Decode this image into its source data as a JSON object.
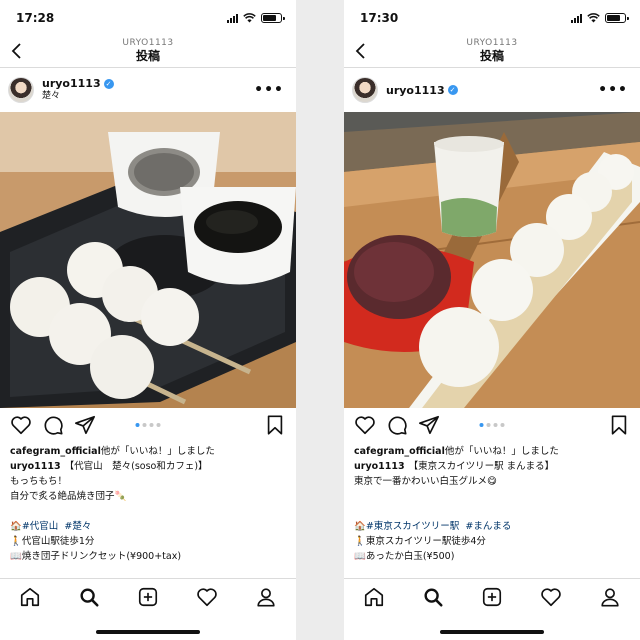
{
  "screens": [
    {
      "status_time": "17:28",
      "nav": {
        "account_id": "URYO1113",
        "title": "投稿"
      },
      "post": {
        "username": "uryo1113",
        "location": "楚々",
        "liked_by_user": "cafegram_official",
        "liked_by_text": "他が「いいね！」しました",
        "caption_user": "uryo1113",
        "caption_lines": [
          "【代官山　楚々(soso和カフェ)】",
          "もっちもち！",
          "自分で炙る絶品焼き団子🍡"
        ],
        "tags_prefix": "🏠",
        "tags": [
          "#代官山",
          "#楚々"
        ],
        "access": "🚶代官山駅徒歩1分",
        "menu": "📖焼き団子ドリンクセット(¥900+tax)"
      }
    },
    {
      "status_time": "17:30",
      "nav": {
        "account_id": "URYO1113",
        "title": "投稿"
      },
      "post": {
        "username": "uryo1113",
        "location": "",
        "liked_by_user": "cafegram_official",
        "liked_by_text": "他が「いいね！」しました",
        "caption_user": "uryo1113",
        "caption_lines": [
          "【東京スカイツリー駅 まんまる】",
          "東京で一番かわいい白玉グルメ😋"
        ],
        "tags_prefix": "🏠",
        "tags": [
          "#東京スカイツリー駅",
          "#まんまる"
        ],
        "access": "🚶東京スカイツリー駅徒歩4分",
        "menu": "📖あったか白玉(¥500)"
      }
    }
  ],
  "icons": {
    "back": "chevron-left-icon",
    "more": "more-icon",
    "like": "heart-icon",
    "comment": "comment-icon",
    "share": "paper-plane-icon",
    "save": "bookmark-icon",
    "tabs": [
      "home-icon",
      "search-icon",
      "add-icon",
      "activity-icon",
      "profile-icon"
    ]
  },
  "colors": {
    "verified": "#3897f0",
    "hashtag": "#003569",
    "carousel_active": "#3897f0"
  }
}
